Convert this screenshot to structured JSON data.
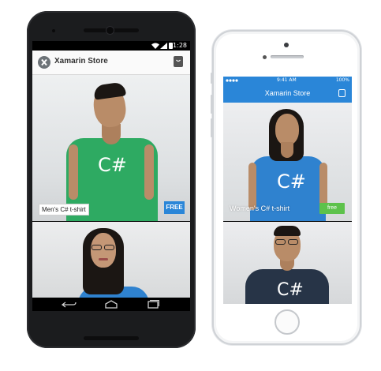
{
  "android": {
    "status_time": "11:28",
    "app_title": "Xamarin Store",
    "products": [
      {
        "name": "Men's C# t-shirt",
        "price": "FREE",
        "shirt_text": "C#"
      },
      {
        "name": "",
        "price": "",
        "shirt_text": ""
      }
    ]
  },
  "iphone": {
    "status_time": "9:41 AM",
    "battery": "100%",
    "app_title": "Xamarin Store",
    "products": [
      {
        "name": "Women's C# t-shirt",
        "price": "free",
        "shirt_text": "C#"
      },
      {
        "name": "",
        "price": "",
        "shirt_text": "C#"
      }
    ]
  },
  "colors": {
    "ios_accent": "#2a86d8",
    "android_price": "#2a86d8",
    "ios_price": "#5dc24b",
    "green_shirt": "#2eaa62",
    "blue_shirt": "#2f82cf",
    "navy_shirt": "#273447"
  },
  "icons": [
    "xamarin-logo-icon",
    "shopping-bag-icon",
    "wifi-icon",
    "signal-icon",
    "battery-icon",
    "back-icon",
    "home-icon",
    "recents-icon"
  ]
}
